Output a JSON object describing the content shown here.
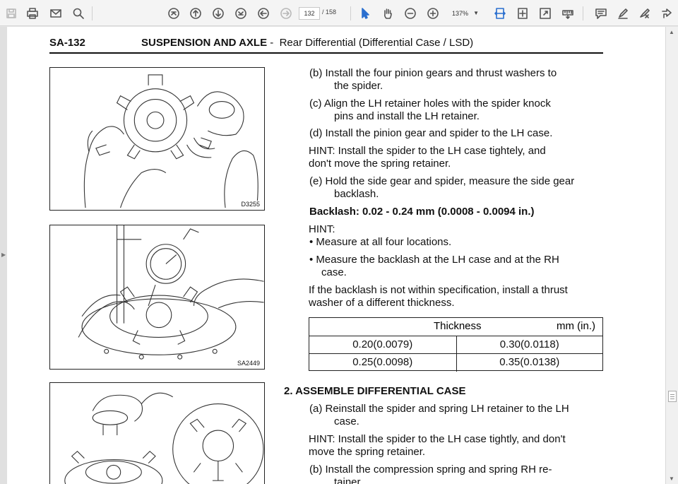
{
  "toolbar": {
    "current_page": "132",
    "total_pages": "/ 158",
    "zoom": "137%",
    "icons": [
      "save-icon",
      "print-icon",
      "email-icon",
      "search-icon",
      "first-page-icon",
      "previous-page-icon",
      "next-page-icon",
      "last-page-icon",
      "back-icon",
      "forward-icon",
      "select-tool-icon",
      "hand-tool-icon",
      "zoom-out-icon",
      "zoom-in-icon",
      "fit-width-icon",
      "fit-page-icon",
      "fullscreen-icon",
      "ruler-icon",
      "comment-icon",
      "highlight-icon",
      "sign-icon",
      "share-icon"
    ]
  },
  "document": {
    "header_code": "SA-132",
    "header_title_bold": "SUSPENSION AND AXLE",
    "header_title_rest": " -  Rear Differential (Differential Case / LSD)",
    "figures": [
      {
        "label": "D3255"
      },
      {
        "label": "SA2449"
      },
      {
        "label": ""
      }
    ],
    "lines": {
      "b1": "(b)   Install the four pinion gears and thrust washers to",
      "b2": "the spider.",
      "c1": "(c)   Align the LH retainer holes with the spider knock",
      "c2": "pins and install the LH retainer.",
      "d1": "(d)   Install the pinion gear and spider to the LH case.",
      "hint1a": "HINT:   Install the spider to the LH case tightely, and",
      "hint1b": "don't move the spring retainer.",
      "e1": "(e)   Hold the side gear and spider, measure the side gear",
      "e2": "backlash.",
      "backlash": "Backlash:   0.02  -  0.24 mm  (0.0008  -  0.0094 in.)",
      "hint2": "HINT:",
      "bul1": "•  Measure at all four locations.",
      "bul2a": "•  Measure the backlash at the LH case and at the RH",
      "bul2b": "case.",
      "if1": "If the backlash is not within specification, install a thrust",
      "if2": "washer of a different thickness.",
      "s2": "2.    ASSEMBLE DIFFERENTIAL CASE",
      "a1": "(a)   Reinstall the spider and spring LH retainer to the LH",
      "a2": "case.",
      "hint3a": "HINT:   Install the spider to the LH case tightly, and don't",
      "hint3b": "move the spring retainer.",
      "b21": "(b)   Install the compression spring and spring RH re-",
      "b22": "tainer."
    },
    "table": {
      "head_left": "Thickness",
      "head_right": "mm  (in.)",
      "rows": [
        [
          "0.20(0.0079)",
          "0.30(0.0118)"
        ],
        [
          "0.25(0.0098)",
          "0.35(0.0138)"
        ]
      ]
    }
  }
}
